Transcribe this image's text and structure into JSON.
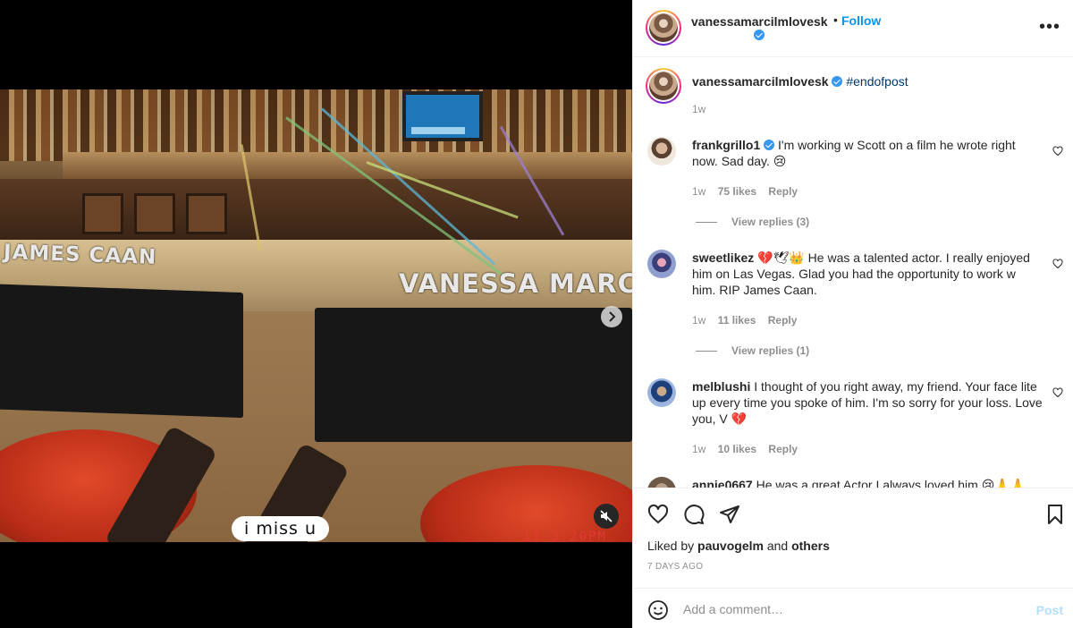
{
  "media": {
    "chair_left_text": "JAMES CAAN",
    "chair_right_text": "VANESSA MARCIL",
    "caption": "i miss u",
    "stamp": "11 3:20PM"
  },
  "header": {
    "username": "vanessamarcilmlovesk",
    "follow_label": "Follow",
    "separator": "•",
    "more_label": "•••"
  },
  "caption": {
    "username": "vanessamarcilmlovesk",
    "text": "#endofpost",
    "time": "1w"
  },
  "comments": [
    {
      "username": "frankgrillo1",
      "verified": true,
      "text": "I'm working w Scott on a film he wrote right now. Sad day. 😢",
      "time": "1w",
      "likes": "75 likes",
      "reply": "Reply",
      "view_replies": "View replies (3)"
    },
    {
      "username": "sweetlikez",
      "text": "💔🕊👑 He was a talented actor. I really enjoyed him on Las Vegas. Glad you had the opportunity to work w him. RIP James Caan.",
      "time": "1w",
      "likes": "11 likes",
      "reply": "Reply",
      "view_replies": "View replies (1)"
    },
    {
      "username": "melblushi",
      "text": "I thought of you right away, my friend. Your face lite up every time you spoke of him. I'm so sorry for your loss. Love you, V 💔",
      "time": "1w",
      "likes": "10 likes",
      "reply": "Reply"
    },
    {
      "username": "annie0667",
      "text": "He was a great Actor I always loved him 😢🙏🙏"
    }
  ],
  "likes": {
    "prefix": "Liked by",
    "user": "pauvogelm",
    "and": "and",
    "others": "others"
  },
  "date": "7 DAYS AGO",
  "add_comment": {
    "placeholder": "Add a comment…",
    "post_label": "Post"
  },
  "colors": {
    "follow": "#0095f6",
    "verified": "#3897f0",
    "hashtag": "#00376b",
    "heart": "#ed4956",
    "post_disabled": "#b2dffc"
  }
}
